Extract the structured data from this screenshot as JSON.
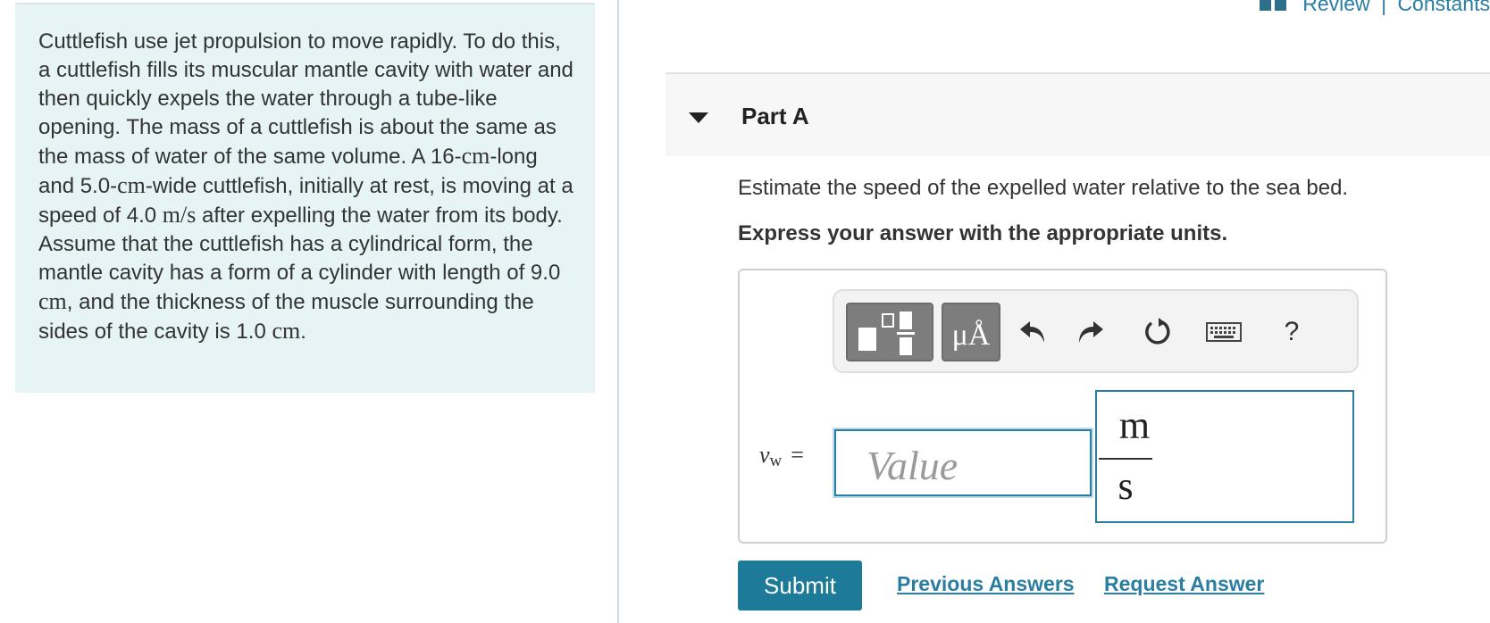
{
  "problem": {
    "segments": [
      {
        "t": "Cuttlefish use jet propulsion to move rapidly. To do this, a cuttlefish fills its muscular mantle cavity with water and then quickly expels the water through a tube-like opening. The mass of a cuttlefish is about the same as the mass of water of the same volume. A 16-"
      },
      {
        "u": "cm"
      },
      {
        "t": "-long and 5.0-"
      },
      {
        "u": "cm"
      },
      {
        "t": "-wide cuttlefish, initially at rest, is moving at a speed of 4.0 "
      },
      {
        "u": "m/s"
      },
      {
        "t": " after expelling the water from its body. Assume that the cuttlefish has a cylindrical form, the mantle cavity has a form of a cylinder with length of 9.0 "
      },
      {
        "u": "cm"
      },
      {
        "t": ", and the thickness of the muscle surrounding the sides of the cavity is 1.0 "
      },
      {
        "u": "cm"
      },
      {
        "t": "."
      }
    ]
  },
  "header": {
    "review_label": "Review",
    "separator": "|",
    "constants_label": "Constants"
  },
  "part": {
    "title": "Part A",
    "question": "Estimate the speed of the expelled water relative to the sea bed.",
    "instruction": "Express your answer with the appropriate units."
  },
  "toolbar": {
    "units_button_label": "μÅ",
    "help_label": "?",
    "icons": [
      "fraction-template-icon",
      "units-icon",
      "undo-icon",
      "redo-icon",
      "reset-icon",
      "keyboard-icon",
      "help-icon"
    ]
  },
  "answer": {
    "variable": "v",
    "subscript": "w",
    "equals": "=",
    "value_placeholder": "Value",
    "value": "",
    "unit_numerator": "m",
    "unit_denominator": "s"
  },
  "actions": {
    "submit_label": "Submit",
    "previous_answers_label": "Previous Answers",
    "request_answer_label": "Request Answer"
  },
  "colors": {
    "accent": "#2a7ea2",
    "submit_bg": "#1d7a98",
    "problem_bg": "#e6f4f5",
    "toolbar_button": "#7d7d7d"
  }
}
